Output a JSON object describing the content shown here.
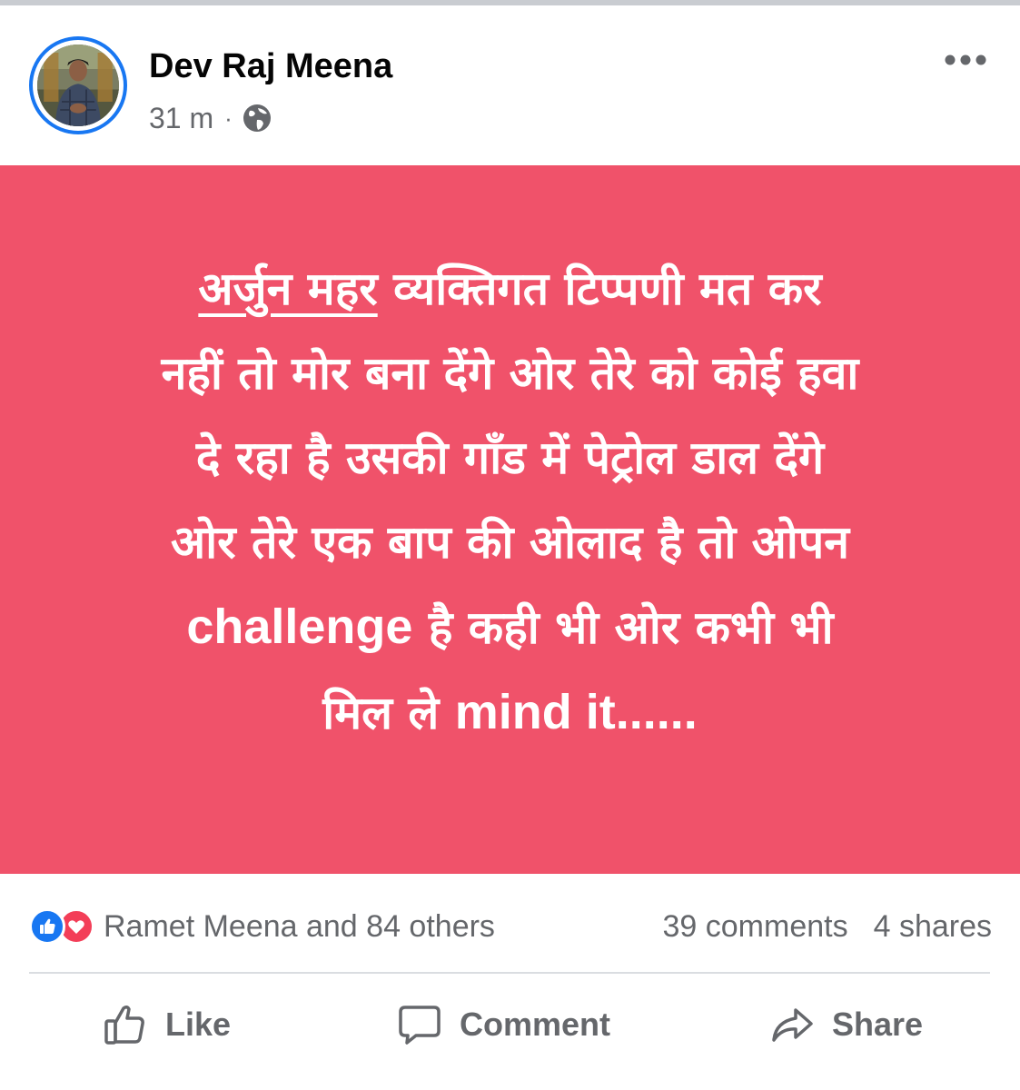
{
  "post": {
    "author": "Dev Raj Meena",
    "time": "31 m",
    "separator": "·",
    "privacy_icon": "globe-icon",
    "more_icon": "more-options-icon",
    "background_color": "#f0526a",
    "text_color": "#ffffff",
    "text": {
      "line1_tag": "अर्जुन महर",
      "line1_rest": " व्यक्तिगत टिप्पणी मत कर",
      "line2": "नहीं तो मोर बना देंगे ओर तेरे को कोई हवा",
      "line3": "दे रहा है उसकी गाँड में पेट्रोल डाल देंगे",
      "line4": "ओर तेरे एक बाप की ओलाद है तो ओपन",
      "line5_latin": "challenge",
      "line5_rest": " है कही भी ओर कभी भी",
      "line6_start": "मिल ले ",
      "line6_latin": "mind it......"
    }
  },
  "reactions": {
    "icons": [
      "like-reaction-icon",
      "love-reaction-icon"
    ],
    "summary": "Ramet Meena and 84 others",
    "comments": "39 comments",
    "shares": "4 shares"
  },
  "actions": {
    "like_label": "Like",
    "comment_label": "Comment",
    "share_label": "Share"
  },
  "colors": {
    "brand_blue": "#1877f2",
    "love_red": "#f33e58",
    "secondary_text": "#65676b"
  }
}
